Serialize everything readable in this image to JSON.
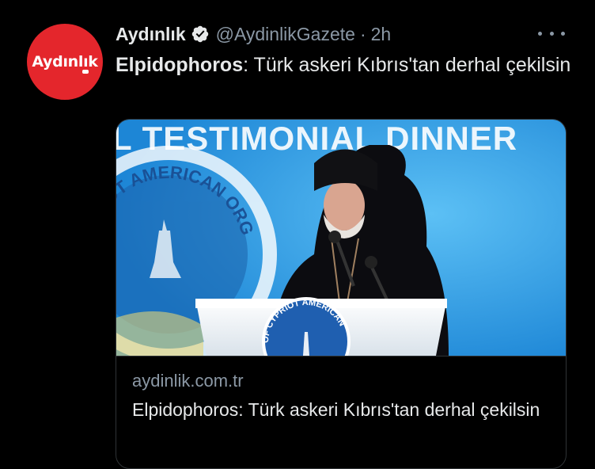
{
  "tweet": {
    "avatar": {
      "logo_text": "Aydınlık"
    },
    "author": {
      "name": "Aydınlık",
      "handle": "@AydinlikGazete",
      "separator": "·",
      "time": "2h"
    },
    "icons": {
      "verified": "verified-badge-icon",
      "more": "more-options-icon"
    },
    "text": {
      "bold_part": "Elpidophoros",
      "rest": ": Türk askeri Kıbrıs'tan derhal çekilsin"
    },
    "card": {
      "image": {
        "banner_text": "L TESTIMONIAL DINNER",
        "seal_text": "CYPRIOT AMERICAN ORG",
        "podium_seal_text": "OF CYPRIOT AMERICAN"
      },
      "domain": "aydinlik.com.tr",
      "title": "Elpidophoros: Türk askeri Kıbrıs'tan derhal çekilsin"
    }
  },
  "colors": {
    "background": "#000000",
    "primary_text": "#e7e9ea",
    "secondary_text": "#8b98a5",
    "avatar_red": "#e4262c",
    "verified_blue": "#e7e9ea",
    "card_border": "#2f3336"
  }
}
